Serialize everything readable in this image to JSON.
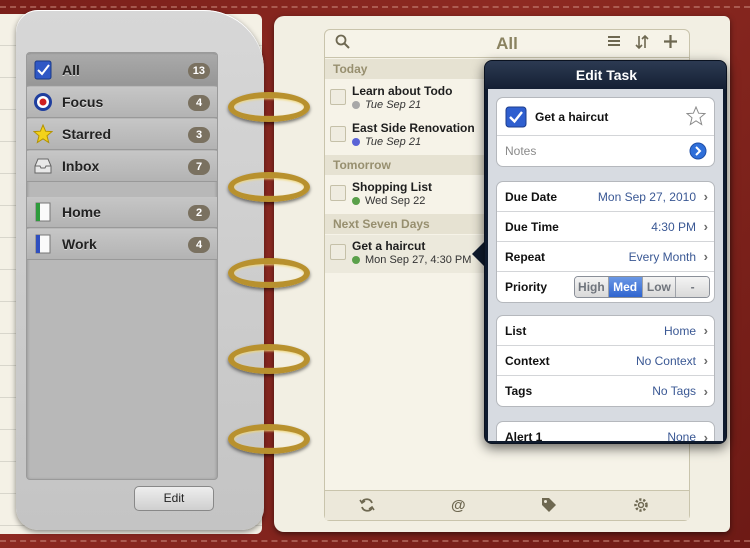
{
  "sidebar": {
    "items": [
      {
        "label": "All",
        "count": "13",
        "icon": "checkbox-icon"
      },
      {
        "label": "Focus",
        "count": "4",
        "icon": "target-icon"
      },
      {
        "label": "Starred",
        "count": "3",
        "icon": "star-icon"
      },
      {
        "label": "Inbox",
        "count": "7",
        "icon": "inbox-icon"
      }
    ],
    "folders": [
      {
        "label": "Home",
        "count": "2",
        "icon": "notebook-green-icon"
      },
      {
        "label": "Work",
        "count": "4",
        "icon": "notebook-blue-icon"
      }
    ],
    "edit_label": "Edit"
  },
  "list": {
    "title": "All",
    "sections": [
      {
        "header": "Today"
      },
      {
        "header": "Tomorrow"
      },
      {
        "header": "Next Seven Days"
      }
    ],
    "tasks": [
      {
        "title": "Learn about Todo",
        "date": "Tue Sep 21",
        "dot_color": "#a8a8a8"
      },
      {
        "title": "East Side Renovation",
        "date": "Tue Sep 21",
        "dot_color": "#5a63d6"
      },
      {
        "title": "Shopping List",
        "date": "Wed Sep 22",
        "dot_color": "#5aa04a"
      },
      {
        "title": "Get a haircut",
        "date": "Mon Sep 27, 4:30 PM",
        "dot_color": "#5aa04a"
      }
    ]
  },
  "edit_task": {
    "title": "Edit Task",
    "task_name": "Get a haircut",
    "notes_placeholder": "Notes",
    "due_date_label": "Due Date",
    "due_date_value": "Mon Sep 27, 2010",
    "due_time_label": "Due Time",
    "due_time_value": "4:30 PM",
    "repeat_label": "Repeat",
    "repeat_value": "Every Month",
    "priority_label": "Priority",
    "priority_options": [
      "High",
      "Med",
      "Low",
      "-"
    ],
    "priority_selected": "Med",
    "list_label": "List",
    "list_value": "Home",
    "context_label": "Context",
    "context_value": "No Context",
    "tags_label": "Tags",
    "tags_value": "No Tags",
    "alert_label": "Alert 1",
    "alert_value": "None"
  },
  "colors": {
    "accent_blue": "#2e64cf",
    "leather": "#7a1f1a",
    "badge": "#7a7160"
  }
}
